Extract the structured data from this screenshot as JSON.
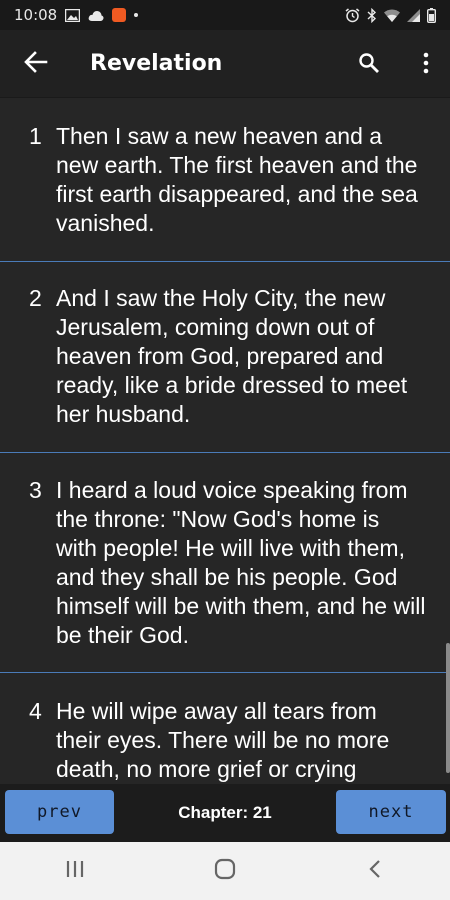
{
  "status_bar": {
    "time": "10:08",
    "icons_left": [
      "image-icon",
      "cloud-icon",
      "app-badge-icon",
      "dot-icon"
    ],
    "icons_right": [
      "alarm-icon",
      "bluetooth-icon",
      "wifi-icon",
      "signal-icon",
      "battery-icon"
    ]
  },
  "app_bar": {
    "title": "Revelation",
    "back_icon": "arrow-left-icon",
    "search_icon": "search-icon",
    "more_icon": "more-vert-icon"
  },
  "verses": [
    {
      "num": "1",
      "text": "Then I saw a new heaven and a new earth. The first heaven and the first earth disappeared, and the sea vanished."
    },
    {
      "num": "2",
      "text": "And I saw the Holy City, the new Jerusalem, coming down out of heaven from God, prepared and ready, like a bride dressed to meet her husband."
    },
    {
      "num": "3",
      "text": "I heard a loud voice speaking from the throne: \"Now God's home is with people! He will live with them, and they shall be his people. God himself will be with them, and he will be their God."
    },
    {
      "num": "4",
      "text": "He will wipe away all tears from their eyes. There will be no more death, no more grief or crying"
    }
  ],
  "chapter_nav": {
    "prev_label": "prev",
    "next_label": "next",
    "chapter_label": "Chapter: 21"
  },
  "system_nav": {
    "recents_icon": "recents-icon",
    "home_icon": "home-icon",
    "back_icon": "back-chevron-icon"
  },
  "colors": {
    "background": "#262626",
    "accent_button": "#5b8fd6",
    "divider": "#4a7bb8"
  }
}
